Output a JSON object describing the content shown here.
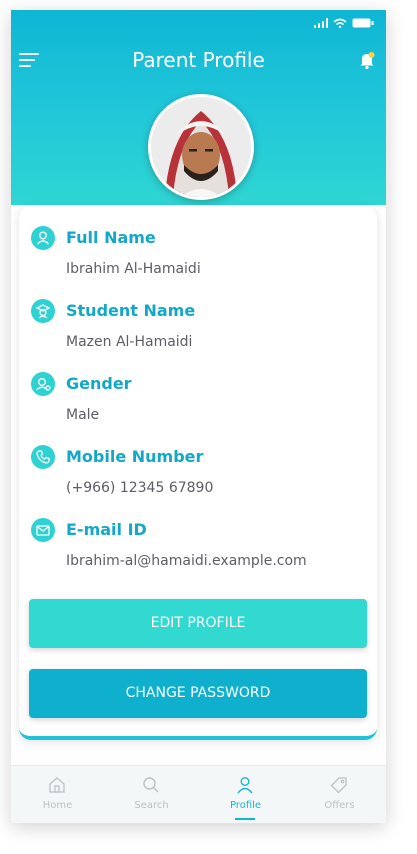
{
  "header": {
    "title": "Parent Profile"
  },
  "profile": {
    "fields": [
      {
        "label": "Full Name",
        "value": "Ibrahim Al-Hamaidi",
        "icon": "user-icon"
      },
      {
        "label": "Student Name",
        "value": "Mazen Al-Hamaidi",
        "icon": "student-icon"
      },
      {
        "label": "Gender",
        "value": "Male",
        "icon": "gender-icon"
      },
      {
        "label": "Mobile Number",
        "value": "(+966) 12345 67890",
        "icon": "phone-icon"
      },
      {
        "label": "E-mail ID",
        "value": "Ibrahim-al@hamaidi.example.com",
        "icon": "mail-icon"
      }
    ]
  },
  "actions": {
    "edit_label": "EDIT PROFILE",
    "password_label": "CHANGE PASSWORD"
  },
  "tabbar": {
    "items": [
      {
        "label": "Home",
        "icon": "home-icon"
      },
      {
        "label": "Search",
        "icon": "search-icon"
      },
      {
        "label": "Profile",
        "icon": "profile-icon",
        "active": true
      },
      {
        "label": "Offers",
        "icon": "tag-icon"
      }
    ]
  },
  "colors": {
    "primary": "#14a8c8",
    "accent": "#31d9d0",
    "button_dark": "#0fb0cd"
  }
}
